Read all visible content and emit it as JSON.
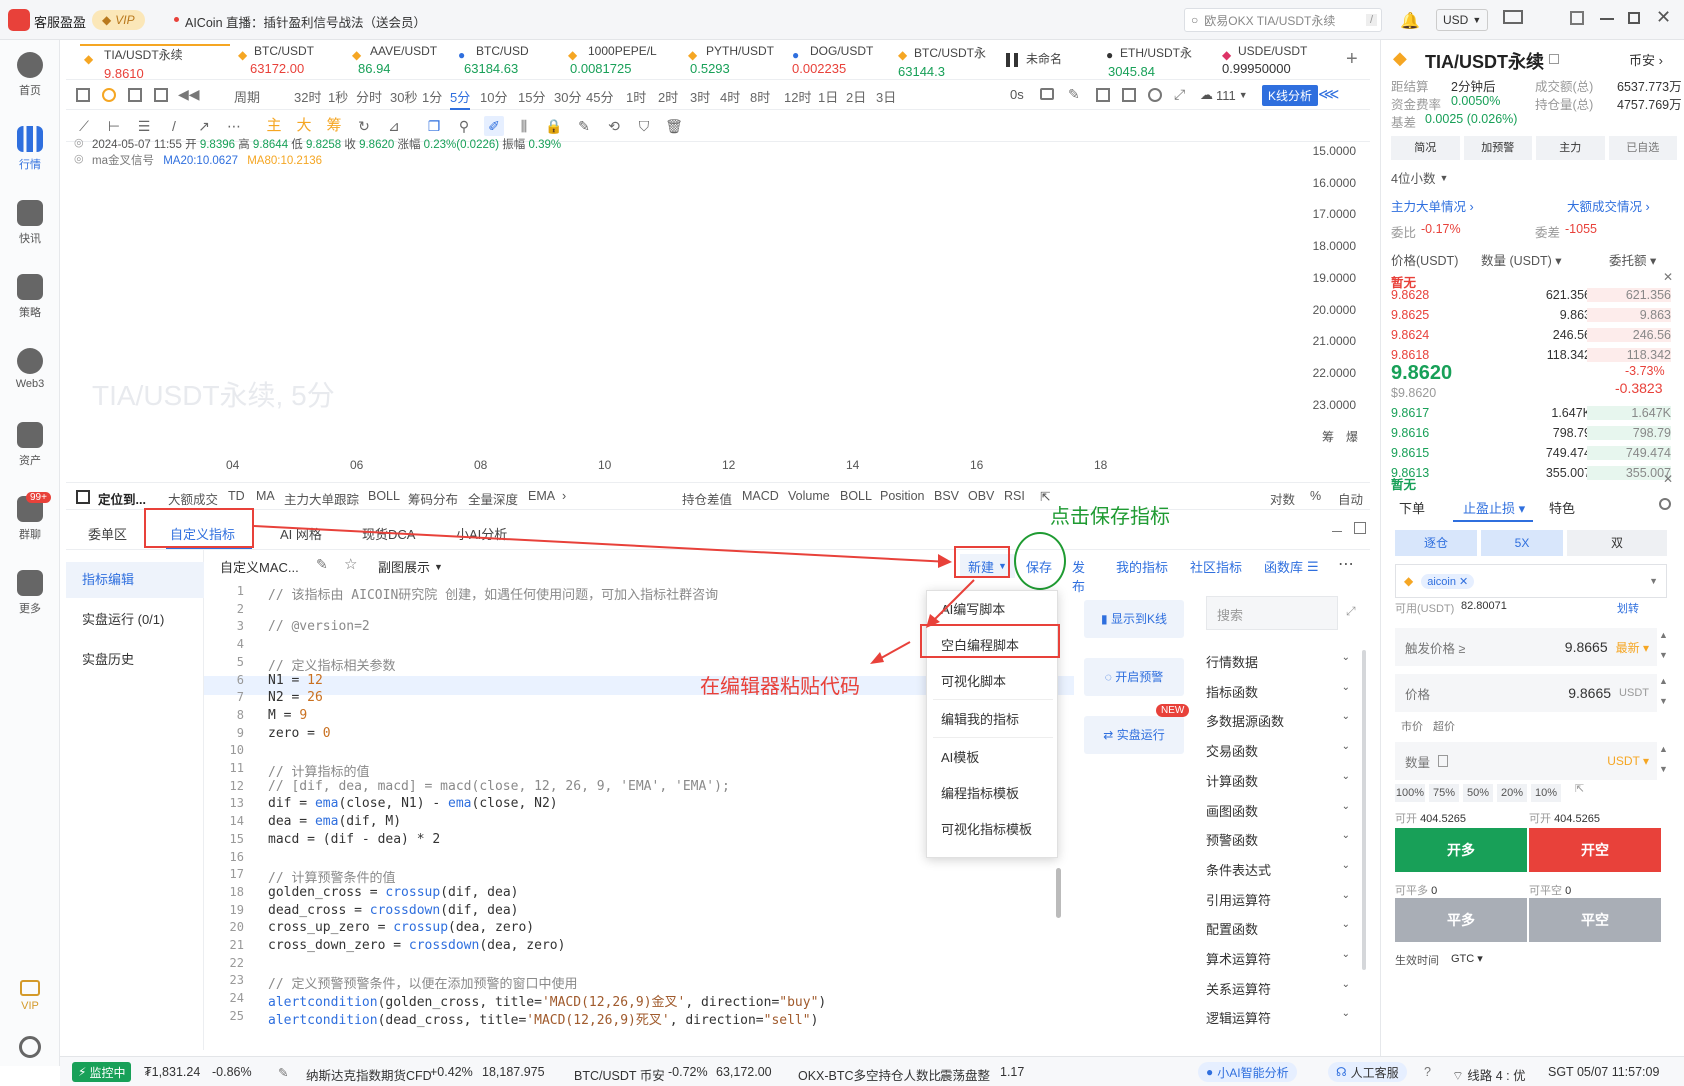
{
  "topbar": {
    "app_name": "客服盈盈",
    "vip": "VIP",
    "live_text": "AICoin 直播：插针盈利信号战法（送会员）",
    "search_placeholder": "欧易OKX TIA/USDT永续",
    "search_key": "/",
    "currency": "USD"
  },
  "sidebar": [
    {
      "label": "首页",
      "icon": "globe-icon"
    },
    {
      "label": "行情",
      "icon": "bar-chart-icon"
    },
    {
      "label": "快讯",
      "icon": "news-icon"
    },
    {
      "label": "策略",
      "icon": "robot-icon"
    },
    {
      "label": "Web3",
      "icon": "web3-icon"
    },
    {
      "label": "资产",
      "icon": "wallet-icon"
    },
    {
      "label": "群聊",
      "icon": "chat-icon",
      "badge": "99+"
    },
    {
      "label": "更多",
      "icon": "grid-icon"
    },
    {
      "label": "VIP",
      "icon": "vip-diamond-icon"
    },
    {
      "label": "",
      "icon": "settings-icon"
    }
  ],
  "pair_tabs": [
    {
      "name": "TIA/USDT永续",
      "price": "9.8610",
      "color": "red"
    },
    {
      "name": "BTC/USDT",
      "price": "63172.00",
      "color": "red"
    },
    {
      "name": "AAVE/USDT",
      "price": "86.94",
      "color": "grn"
    },
    {
      "name": "BTC/USD",
      "price": "63184.63",
      "color": "grn"
    },
    {
      "name": "1000PEPE/L",
      "price": "0.0081725",
      "color": "grn"
    },
    {
      "name": "PYTH/USDT",
      "price": "0.5293",
      "color": "grn"
    },
    {
      "name": "DOG/USDT",
      "price": "0.002235",
      "color": "red"
    },
    {
      "name": "BTC/USDT永",
      "price": "63144.3",
      "color": "grn"
    },
    {
      "name": "未命名",
      "price": "",
      "color": "grn"
    },
    {
      "name": "ETH/USDT永",
      "price": "3045.84",
      "color": "grn"
    },
    {
      "name": "USDE/USDT",
      "price": "0.99950000",
      "color": "grn"
    }
  ],
  "timeframes": [
    "周期",
    "32时",
    "1秒",
    "分时",
    "30秒",
    "1分",
    "5分",
    "10分",
    "15分",
    "30分",
    "45分",
    "1时",
    "2时",
    "3时",
    "4时",
    "8时",
    "12时",
    "1日",
    "2日",
    "3日"
  ],
  "timeframe_active": "5分",
  "tf_right": {
    "zero_s": "0s",
    "cloud_count": "111",
    "kline_btn": "K线分析"
  },
  "draw_tools": [
    "主",
    "大",
    "筹"
  ],
  "chart": {
    "info_line1": "2024-05-07 11:55 开 9.8396 高 9.8644 低 9.8258 收 9.8620 涨幅 0.23%(0.0226) 振幅 0.39%",
    "info_date": "2024-05-07 11:55",
    "info_open": "9.8396",
    "info_high": "9.8644",
    "info_low": "9.8258",
    "info_close": "9.8620",
    "info_change": "0.23%(0.0226)",
    "info_amp": "0.39%",
    "ma_label": "ma金叉信号",
    "ma20": "MA20:10.0627",
    "ma80": "MA80:10.2136",
    "watermark": "TIA/USDT永续, 5分",
    "y_ticks": [
      "15.0000",
      "16.0000",
      "17.0000",
      "18.0000",
      "19.0000",
      "20.0000",
      "21.0000",
      "22.0000",
      "23.0000"
    ],
    "x_ticks": [
      "04",
      "06",
      "08",
      "10",
      "12",
      "14",
      "16",
      "18"
    ],
    "y_right_labels": [
      "筹",
      "爆"
    ]
  },
  "indicator_bar": {
    "left": [
      "定位到...",
      "大额成交",
      "TD",
      "MA",
      "主力大单跟踪",
      "BOLL",
      "筹码分布",
      "全量深度",
      "EMA"
    ],
    "right": [
      "持仓差值",
      "MACD",
      "Volume",
      "BOLL",
      "Position",
      "BSV",
      "OBV",
      "RSI"
    ],
    "far": [
      "对数",
      "%",
      "自动"
    ]
  },
  "bottom_tabs": [
    "委单区",
    "自定义指标",
    "AI 网格",
    "现货DCA",
    "小AI分析"
  ],
  "left_menu": [
    "指标编辑",
    "实盘运行 (0/1)",
    "实盘历史"
  ],
  "editor_head": {
    "script_name": "自定义MAC...",
    "display": "副图展示",
    "new_btn": "新建",
    "save": "保存",
    "publish": "发布",
    "my_ind": "我的指标",
    "community": "社区指标",
    "library": "函数库"
  },
  "code_lines": [
    "// 该指标由 AICOIN研究院 创建，如遇任何使用问题，可加入指标社群咨询",
    "",
    "// @version=2",
    "",
    "// 定义指标相关参数",
    "N1 = 12",
    "N2 = 26",
    "M = 9",
    "zero = 0",
    "",
    "// 计算指标的值",
    "// [dif, dea, macd] = macd(close, 12, 26, 9, 'EMA', 'EMA');",
    "dif = ema(close, N1) - ema(close, N2)",
    "dea = ema(dif, M)",
    "macd = (dif - dea) * 2",
    "",
    "// 计算预警条件的值",
    "golden_cross = crossup(dif, dea)",
    "dead_cross = crossdown(dif, dea)",
    "cross_up_zero = crossup(dea, zero)",
    "cross_down_zero = crossdown(dea, zero)",
    "",
    "// 定义预警预警条件，以便在添加预警的窗口中使用",
    "alertcondition(golden_cross, title='MACD(12,26,9)金叉', direction=\"buy\")",
    "alertcondition(dead_cross, title='MACD(12,26,9)死叉', direction=\"sell\")"
  ],
  "dropdown": [
    "AI编写脚本",
    "空白编程脚本",
    "可视化脚本",
    "编辑我的指标",
    "AI模板",
    "编程指标模板",
    "可视化指标模板"
  ],
  "mid_buttons": [
    "显示到K线",
    "开启预警",
    "实盘运行"
  ],
  "new_badge": "NEW",
  "fn_search": "搜索",
  "fn_list": [
    "行情数据",
    "指标函数",
    "多数据源函数",
    "交易函数",
    "计算函数",
    "画图函数",
    "预警函数",
    "条件表达式",
    "引用运算符",
    "配置函数",
    "算术运算符",
    "关系运算符",
    "逻辑运算符"
  ],
  "annotations": {
    "save_hint": "点击保存指标",
    "paste_hint": "在编辑器粘贴代码"
  },
  "right": {
    "title": "TIA/USDT永续",
    "exchange": "币安",
    "fund_rate_label": "距结算",
    "fund_rate_time": "2分钟后",
    "fund_label": "资金费率",
    "fund_rate": "0.0050%",
    "basis_label": "基差",
    "basis": "0.0025 (0.026%)",
    "vol_label": "成交额(总)",
    "vol": "6537.773万",
    "oi_label": "持仓量(总)",
    "oi": "4757.769万",
    "tabs": [
      "简况",
      "加预警",
      "主力",
      "已自选"
    ],
    "precision": "4位小数",
    "big_order": "主力大单情况",
    "big_trade": "大额成交情况",
    "wb_label": "委比",
    "wb": "-0.17%",
    "wc_label": "委差",
    "wc": "-1055",
    "col_price": "价格(USDT)",
    "col_qty": "数量 (USDT)",
    "col_total": "委托额",
    "asks": [
      {
        "p": "9.8628",
        "q": "621.356",
        "t": "621.356"
      },
      {
        "p": "9.8625",
        "q": "9.863",
        "t": "9.863"
      },
      {
        "p": "9.8624",
        "q": "246.56",
        "t": "246.56"
      },
      {
        "p": "9.8618",
        "q": "118.342",
        "t": "118.342"
      }
    ],
    "last_price": "9.8620",
    "last_usd": "$9.8620",
    "chg_pct": "-3.73%",
    "chg_abs": "-0.3823",
    "bids": [
      {
        "p": "9.8617",
        "q": "1.647K",
        "t": "1.647K"
      },
      {
        "p": "9.8616",
        "q": "798.79",
        "t": "798.79"
      },
      {
        "p": "9.8615",
        "q": "749.474",
        "t": "749.474"
      },
      {
        "p": "9.8613",
        "q": "355.007",
        "t": "355.007"
      }
    ],
    "none_label": "暂无",
    "order_tabs": [
      "下单",
      "止盈止损",
      "特色"
    ],
    "mode": [
      "逐仓",
      "5X",
      "双"
    ],
    "coupon": "aicoin",
    "avail_label": "可用(USDT)",
    "avail": "82.80071",
    "transfer": "划转",
    "trigger_label": "触发价格 ≥",
    "trigger_val": "9.8665",
    "trigger_type": "最新",
    "price_label": "价格",
    "price_val": "9.8665",
    "price_unit": "USDT",
    "market": "市价",
    "super": "超价",
    "qty_label": "数量",
    "qty_unit": "USDT",
    "pcts": [
      "100%",
      "75%",
      "50%",
      "20%",
      "10%"
    ],
    "open_l_label": "可开",
    "open_l": "404.5265",
    "open_s_label": "可开",
    "open_s": "404.5265",
    "buy": "开多",
    "sell": "开空",
    "close_l_label": "可平多",
    "close_l": "0",
    "close_s_label": "可平空",
    "close_s": "0",
    "close_long": "平多",
    "close_short": "平空",
    "tif_label": "生效时间",
    "tif": "GTC"
  },
  "status": {
    "monitor": "监控中",
    "asset": "₮1,831.24",
    "asset_chg": "-0.86%",
    "nasdaq": "纳斯达克指数期货CFD",
    "nasdaq_chg": "+0.42%",
    "nasdaq_val": "18,187.975",
    "btc": "BTC/USDT 币安",
    "btc_chg": "-0.72%",
    "btc_val": "63,172.00",
    "okx": "OKX-BTC多空持仓人数比",
    "okx_state": "震荡盘整",
    "okx_val": "1.17",
    "ai": "小AI智能分析",
    "cs": "人工客服",
    "line": "线路 4 : 优",
    "time": "SGT 05/07 11:57:09"
  }
}
